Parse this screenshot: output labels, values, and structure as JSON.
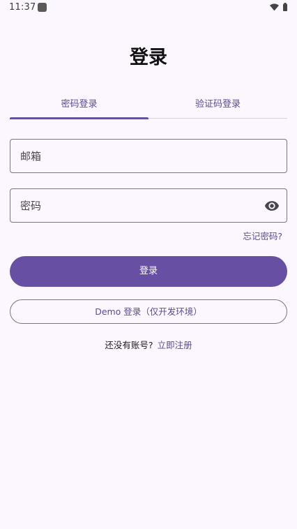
{
  "status_bar": {
    "time": "11:37"
  },
  "page": {
    "title": "登录"
  },
  "tabs": [
    {
      "label": "密码登录",
      "selected": true
    },
    {
      "label": "验证码登录",
      "selected": false
    }
  ],
  "form": {
    "email_placeholder": "邮箱",
    "email_value": "",
    "password_placeholder": "密码",
    "password_value": "",
    "forgot_label": "忘记密码?"
  },
  "actions": {
    "login_label": "登录",
    "demo_label": "Demo 登录（仅开发环境）"
  },
  "register": {
    "prompt": "还没有账号?",
    "link": "立即注册"
  },
  "colors": {
    "accent": "#6750a4",
    "background": "#fcf6fe",
    "link": "#5b4b8f"
  },
  "icons": {
    "password_toggle": "eye-icon",
    "wifi": "wifi-icon",
    "battery": "battery-icon"
  }
}
